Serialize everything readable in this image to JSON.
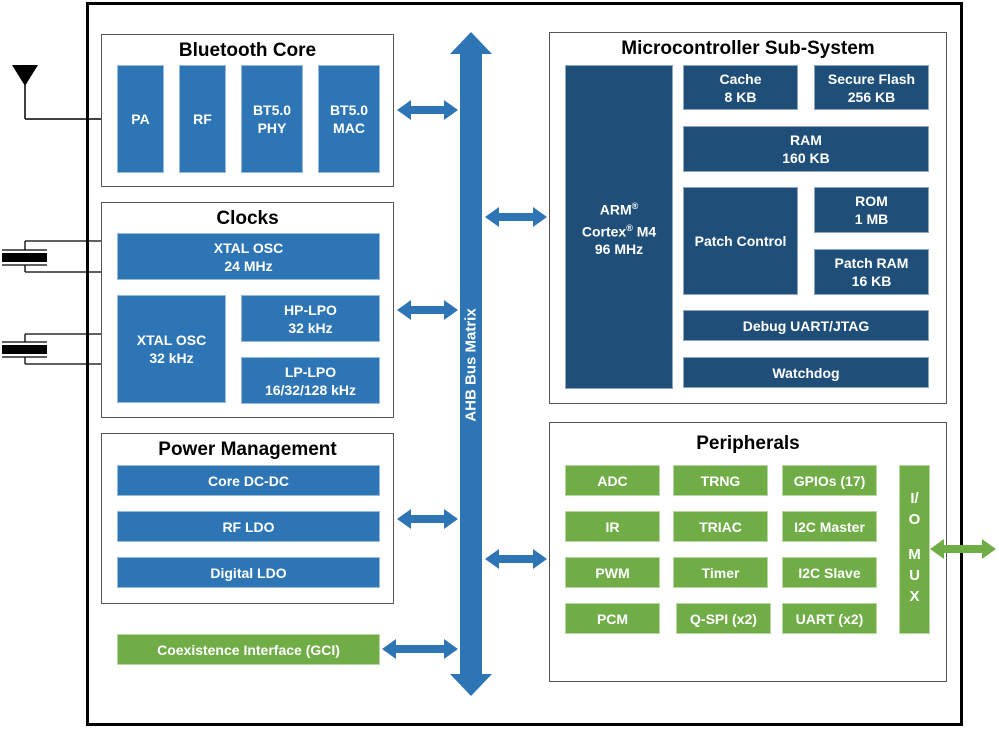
{
  "colors": {
    "blue_block": "#2e75b6",
    "navy_block": "#1f4e79",
    "green_block": "#70ad47",
    "bus": "#2e75b6",
    "io_arrow": "#70ad47"
  },
  "bus": {
    "label": "AHB Bus Matrix"
  },
  "bluetooth_core": {
    "title": "Bluetooth Core",
    "blocks": [
      {
        "line1": "PA",
        "line2": ""
      },
      {
        "line1": "RF",
        "line2": ""
      },
      {
        "line1": "BT5.0",
        "line2": "PHY"
      },
      {
        "line1": "BT5.0",
        "line2": "MAC"
      }
    ]
  },
  "clocks": {
    "title": "Clocks",
    "xtal24": {
      "line1": "XTAL OSC",
      "line2": "24 MHz"
    },
    "xtal32": {
      "line1": "XTAL OSC",
      "line2": "32 kHz"
    },
    "hplpo": {
      "line1": "HP-LPO",
      "line2": "32 kHz"
    },
    "lplpo": {
      "line1": "LP-LPO",
      "line2": "16/32/128 kHz"
    }
  },
  "power": {
    "title": "Power Management",
    "blocks": [
      "Core DC-DC",
      "RF LDO",
      "Digital LDO"
    ]
  },
  "coex": {
    "label": "Coexistence Interface (GCI)"
  },
  "mcu": {
    "title": "Microcontroller Sub-System",
    "cpu": {
      "line1": "ARM",
      "line2a": "Cortex",
      "line2b": " M4",
      "line3": "96 MHz",
      "reg": "®"
    },
    "cache": {
      "line1": "Cache",
      "line2": "8 KB"
    },
    "flash": {
      "line1": "Secure Flash",
      "line2": "256 KB"
    },
    "ram": {
      "line1": "RAM",
      "line2": "160 KB"
    },
    "patch_control": "Patch Control",
    "rom": {
      "line1": "ROM",
      "line2": "1 MB"
    },
    "patch_ram": {
      "line1": "Patch RAM",
      "line2": "16 KB"
    },
    "debug": "Debug UART/JTAG",
    "watchdog": "Watchdog"
  },
  "peripherals": {
    "title": "Peripherals",
    "grid": [
      [
        "ADC",
        "TRNG",
        "GPIOs (17)"
      ],
      [
        "IR",
        "TRIAC",
        "I2C Master"
      ],
      [
        "PWM",
        "Timer",
        "I2C Slave"
      ],
      [
        "PCM",
        "Q-SPI (x2)",
        "UART (x2)"
      ]
    ],
    "iomux": {
      "l1": "I/",
      "l2": "O",
      "l3": "M",
      "l4": "U",
      "l5": "X"
    }
  }
}
